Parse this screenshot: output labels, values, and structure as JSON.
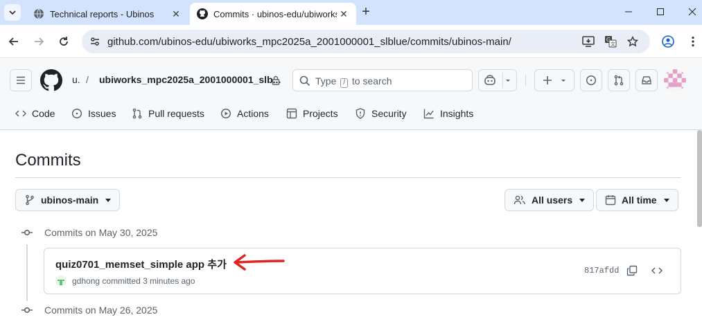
{
  "browser": {
    "tabs": [
      {
        "title": "Technical reports - Ubinos",
        "active": false
      },
      {
        "title": "Commits · ubinos-edu/ubiworks_mpc2025a_2001000001_slblue",
        "active": true
      }
    ],
    "url": "github.com/ubinos-edu/ubiworks_mpc2025a_2001000001_slblue/commits/ubinos-main/"
  },
  "github_header": {
    "owner": "u.",
    "separator": "/",
    "repo": "ubiworks_mpc2025a_2001000001_slb...",
    "search_prefix": "Type",
    "search_key": "/",
    "search_suffix": "to search",
    "nav_tabs": [
      {
        "label": "Code",
        "icon": "code-icon"
      },
      {
        "label": "Issues",
        "icon": "issue-icon"
      },
      {
        "label": "Pull requests",
        "icon": "pull-request-icon"
      },
      {
        "label": "Actions",
        "icon": "play-icon"
      },
      {
        "label": "Projects",
        "icon": "table-icon"
      },
      {
        "label": "Security",
        "icon": "shield-icon"
      },
      {
        "label": "Insights",
        "icon": "graph-icon"
      }
    ]
  },
  "main": {
    "title": "Commits",
    "branch_label": "ubinos-main",
    "users_filter": "All users",
    "time_filter": "All time",
    "groups": [
      {
        "heading": "Commits on May 30, 2025",
        "commits": [
          {
            "message": "quiz0701_memset_simple app 추가",
            "author": "gdhong",
            "action": "committed",
            "when": "3 minutes ago",
            "sha": "817afdd"
          }
        ]
      },
      {
        "heading": "Commits on May 26, 2025",
        "commits": []
      }
    ]
  },
  "colors": {
    "tabstrip": "#d3e3fd",
    "header_bg": "#f6f8fa",
    "border": "#d1d9e0",
    "annotation_arrow": "#e02424"
  }
}
